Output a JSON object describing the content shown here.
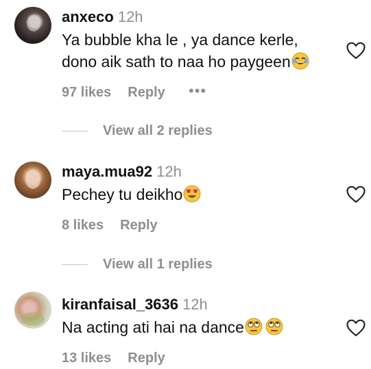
{
  "comments": [
    {
      "username": "anxeco",
      "time": "12h",
      "text_line1": "Ya bubble kha le , ya dance kerle,",
      "text_line2": "dono aik sath to naa ho paygeen",
      "likes": "97 likes",
      "reply": "Reply",
      "more": "•••",
      "emoji": "laughing-emoji"
    },
    {
      "username": "maya.mua92",
      "time": "12h",
      "text": "Pechey tu deikho",
      "likes": "8 likes",
      "reply": "Reply",
      "emoji": "heart-eyes-emoji"
    },
    {
      "username": "kiranfaisal_3636",
      "time": "12h",
      "text": "Na acting ati hai na dance",
      "likes": "13 likes",
      "reply": "Reply",
      "emoji": "eye-roll-emoji"
    }
  ],
  "view_replies": [
    {
      "label": "View all 2 replies"
    },
    {
      "label": "View all 1 replies"
    }
  ],
  "colors": {
    "secondary_text": "#8e8e8e",
    "primary_text": "#111111",
    "heart_outline": "#262626"
  }
}
